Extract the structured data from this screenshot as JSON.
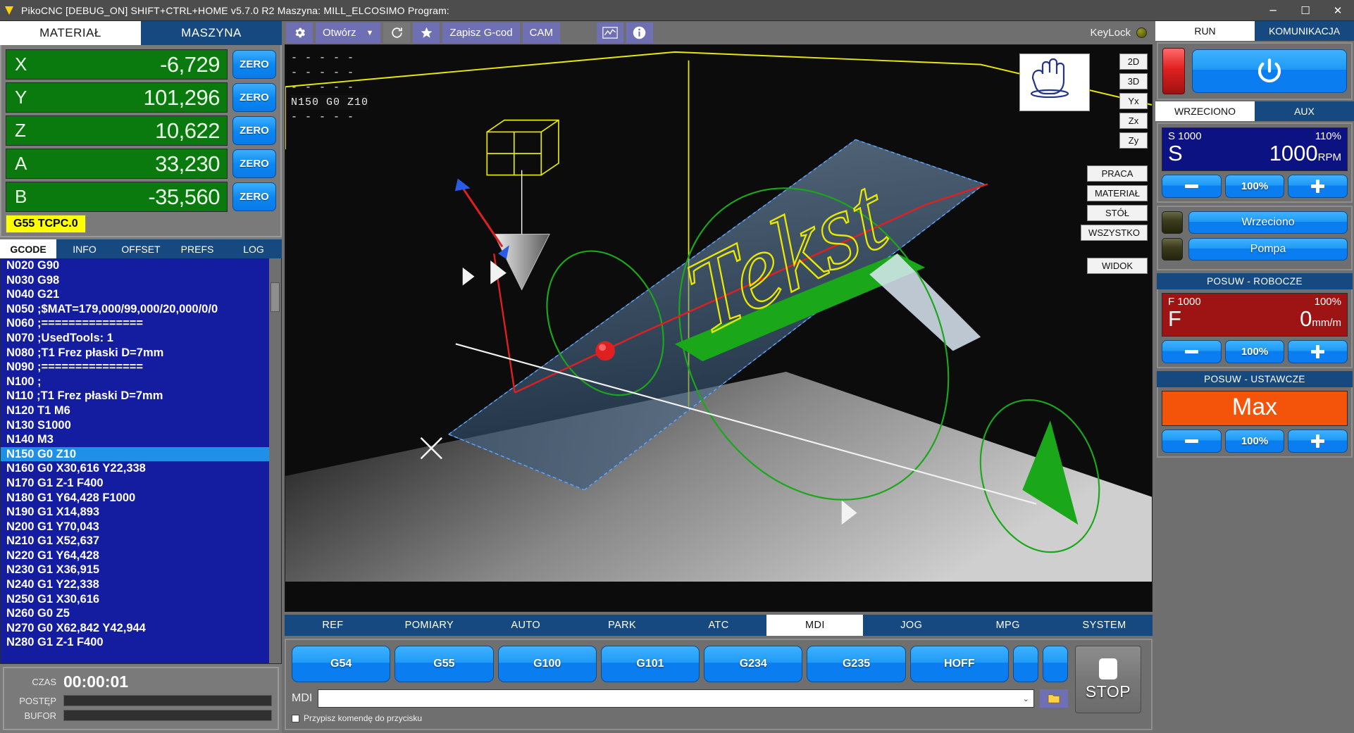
{
  "titlebar": {
    "app_title": "PikoCNC [DEBUG_ON] SHIFT+CTRL+HOME   v5.7.0 R2   Maszyna: MILL_ELCOSIMO   Program:",
    "minimize": "─",
    "maximize": "☐",
    "close": "✕"
  },
  "left": {
    "top_tabs": [
      {
        "label": "MATERIAŁ",
        "active": true
      },
      {
        "label": "MASZYNA",
        "active": false
      }
    ],
    "axes": [
      {
        "name": "X",
        "value": "-6,729",
        "zero": "ZERO"
      },
      {
        "name": "Y",
        "value": "101,296",
        "zero": "ZERO"
      },
      {
        "name": "Z",
        "value": "10,622",
        "zero": "ZERO"
      },
      {
        "name": "A",
        "value": "33,230",
        "zero": "ZERO"
      },
      {
        "name": "B",
        "value": "-35,560",
        "zero": "ZERO"
      }
    ],
    "wcs_badge": "G55 TCPC.0",
    "list_tabs": [
      {
        "label": "GCODE",
        "active": true
      },
      {
        "label": "INFO",
        "active": false
      },
      {
        "label": "OFFSET",
        "active": false
      },
      {
        "label": "PREFS",
        "active": false
      },
      {
        "label": "LOG",
        "active": false
      }
    ],
    "gcode_lines": [
      {
        "text": "N020 G90",
        "selected": false
      },
      {
        "text": "N030 G98",
        "selected": false
      },
      {
        "text": "N040 G21",
        "selected": false
      },
      {
        "text": "N050 ;$MAT=179,000/99,000/20,000/0/0",
        "selected": false
      },
      {
        "text": "N060 ;===============",
        "selected": false
      },
      {
        "text": "N070 ;UsedTools: 1",
        "selected": false
      },
      {
        "text": "N080 ;T1 Frez płaski D=7mm",
        "selected": false
      },
      {
        "text": "N090 ;===============",
        "selected": false
      },
      {
        "text": "N100 ;",
        "selected": false
      },
      {
        "text": "N110 ;T1 Frez płaski D=7mm",
        "selected": false
      },
      {
        "text": "N120 T1 M6",
        "selected": false
      },
      {
        "text": "N130 S1000",
        "selected": false
      },
      {
        "text": "N140 M3",
        "selected": false
      },
      {
        "text": "N150 G0 Z10",
        "selected": true
      },
      {
        "text": "N160 G0 X30,616 Y22,338",
        "selected": false
      },
      {
        "text": "N170 G1 Z-1 F400",
        "selected": false
      },
      {
        "text": "N180 G1 Y64,428 F1000",
        "selected": false
      },
      {
        "text": "N190 G1 X14,893",
        "selected": false
      },
      {
        "text": "N200 G1 Y70,043",
        "selected": false
      },
      {
        "text": "N210 G1 X52,637",
        "selected": false
      },
      {
        "text": "N220 G1 Y64,428",
        "selected": false
      },
      {
        "text": "N230 G1 X36,915",
        "selected": false
      },
      {
        "text": "N240 G1 Y22,338",
        "selected": false
      },
      {
        "text": "N250 G1 X30,616",
        "selected": false
      },
      {
        "text": "N260 G0 Z5",
        "selected": false
      },
      {
        "text": "N270 G0 X62,842 Y42,944",
        "selected": false
      },
      {
        "text": "N280 G1 Z-1 F400",
        "selected": false
      }
    ],
    "status": {
      "time_label": "CZAS",
      "time_value": "00:00:01",
      "progress_label": "POSTĘP",
      "buffer_label": "BUFOR",
      "progress_pct": 0,
      "buffer_pct": 0
    }
  },
  "center": {
    "toolbar": {
      "settings_icon": "gear-icon",
      "open_label": "Otwórz",
      "open_caret": "▼",
      "reload_icon": "reload-icon",
      "favorite_icon": "star-icon",
      "save_gcode_label": "Zapisz G-cod",
      "cam_label": "CAM",
      "graph_icon": "graph-icon",
      "info_icon": "info-icon",
      "keylock_label": "KeyLock"
    },
    "viewport": {
      "overlay_lines": [
        "- - - - -",
        "- - - - -",
        "- - - - -",
        "N150 G0 Z10",
        "- - - - -"
      ],
      "overlay_current_index": 3,
      "hand_icon": "hand-cursor-icon",
      "view_buttons": [
        "2D",
        "3D",
        "Yx",
        "Zx",
        "Zy"
      ],
      "display_buttons": [
        "PRACA",
        "MATERIAŁ",
        "STÓŁ",
        "WSZYSTKO"
      ],
      "view_menu": "WIDOK",
      "model_text": "Tekst"
    },
    "mode_tabs": [
      {
        "label": "REF",
        "active": false
      },
      {
        "label": "POMIARY",
        "active": false
      },
      {
        "label": "AUTO",
        "active": false
      },
      {
        "label": "PARK",
        "active": false
      },
      {
        "label": "ATC",
        "active": false
      },
      {
        "label": "MDI",
        "active": true
      },
      {
        "label": "JOG",
        "active": false
      },
      {
        "label": "MPG",
        "active": false
      },
      {
        "label": "SYSTEM",
        "active": false
      }
    ],
    "mdi": {
      "quick_buttons": [
        "G54",
        "G55",
        "G100",
        "G101",
        "G234",
        "G235",
        "HOFF",
        "",
        ""
      ],
      "input_label": "MDI",
      "input_value": "",
      "input_caret": "⌄",
      "folder_icon": "folder-icon",
      "checkbox_label": "Przypisz komendę do przycisku",
      "checkbox_checked": false,
      "stop_label": "STOP"
    }
  },
  "right": {
    "top_tabs": [
      {
        "label": "RUN",
        "active": true
      },
      {
        "label": "KOMUNIKACJA",
        "active": false
      }
    ],
    "power": {
      "icon": "power-icon"
    },
    "spindle_tabs": [
      {
        "label": "WRZECIONO",
        "active": true
      },
      {
        "label": "AUX",
        "active": false
      }
    ],
    "spindle": {
      "commanded": "S 1000",
      "override_pct": "110%",
      "axis_letter": "S",
      "actual": "1000",
      "unit": "RPM",
      "minus": "minus-icon",
      "reset": "100%",
      "plus": "plus-icon"
    },
    "toggles": [
      {
        "label": "Wrzeciono",
        "on": false
      },
      {
        "label": "Pompa",
        "on": false
      }
    ],
    "feed": {
      "header": "POSUW - ROBOCZE",
      "commanded": "F 1000",
      "override_pct": "100%",
      "axis_letter": "F",
      "actual": "0",
      "unit": "mm/m",
      "minus": "minus-icon",
      "reset": "100%",
      "plus": "plus-icon"
    },
    "rapid": {
      "header": "POSUW - USTAWCZE",
      "value": "Max",
      "minus": "minus-icon",
      "reset": "100%",
      "plus": "plus-icon"
    }
  }
}
